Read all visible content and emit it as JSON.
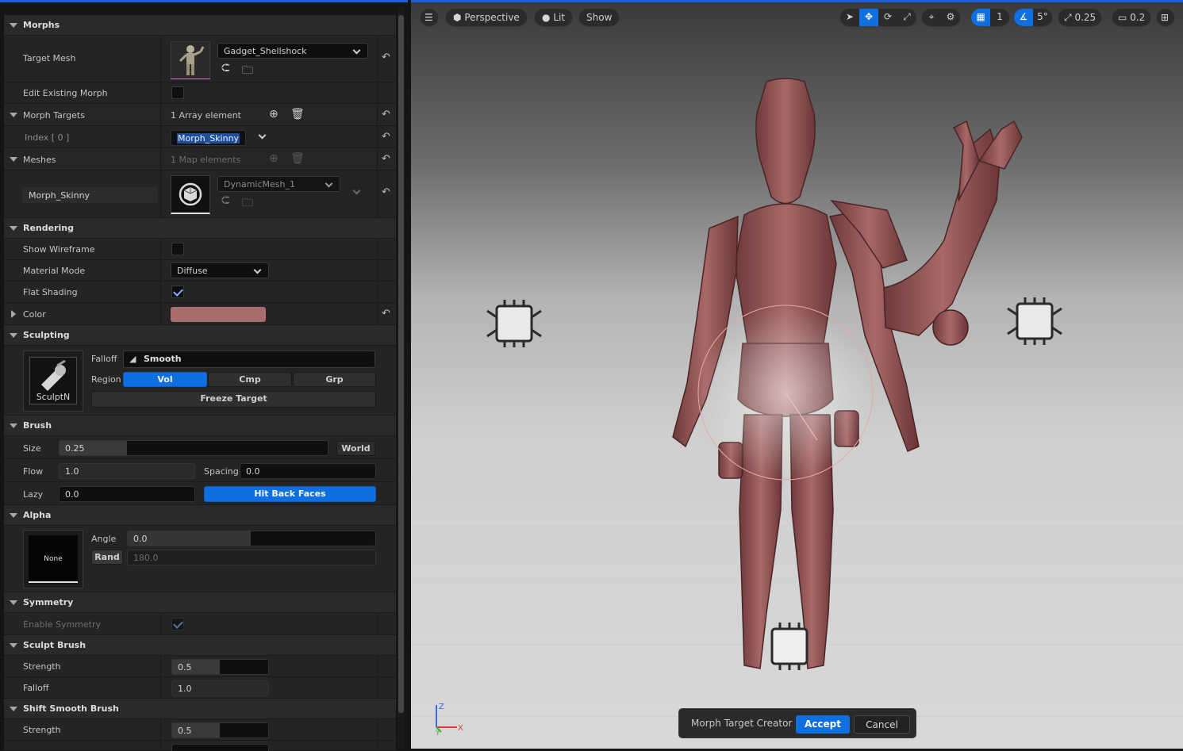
{
  "details": {
    "morphs": {
      "header": "Morphs",
      "target_mesh_label": "Target Mesh",
      "target_mesh_value": "Gadget_Shellshock",
      "edit_existing_label": "Edit Existing Morph",
      "morph_targets_label": "Morph Targets",
      "morph_targets_count": "1 Array element",
      "index_label": "Index [ 0 ]",
      "index_value": "Morph_Skinny",
      "meshes_label": "Meshes",
      "meshes_count": "1 Map elements",
      "mesh_key": "Morph_Skinny",
      "mesh_value": "DynamicMesh_1"
    },
    "rendering": {
      "header": "Rendering",
      "show_wireframe_label": "Show Wireframe",
      "material_mode_label": "Material Mode",
      "material_mode_value": "Diffuse",
      "flat_shading_label": "Flat Shading",
      "flat_shading_checked": true,
      "color_label": "Color",
      "color_value": "#a86e6e"
    },
    "sculpting": {
      "header": "Sculpting",
      "tool_name": "SculptN",
      "falloff_label": "Falloff",
      "falloff_value": "Smooth",
      "region_label": "Region",
      "region_options": [
        "Vol",
        "Cmp",
        "Grp"
      ],
      "region_selected": "Vol",
      "freeze_label": "Freeze Target"
    },
    "brush": {
      "header": "Brush",
      "size_label": "Size",
      "size_value": "0.25",
      "size_fraction": 0.25,
      "world_label": "World",
      "flow_label": "Flow",
      "flow_value": "1.0",
      "spacing_label": "Spacing",
      "spacing_value": "0.0",
      "lazy_label": "Lazy",
      "lazy_value": "0.0",
      "hit_back_faces_label": "Hit Back Faces"
    },
    "alpha": {
      "header": "Alpha",
      "alpha_name": "None",
      "angle_label": "Angle",
      "angle_value": "0.0",
      "rand_label": "Rand",
      "rand_value": "180.0"
    },
    "symmetry": {
      "header": "Symmetry",
      "enable_label": "Enable Symmetry"
    },
    "sculpt_brush": {
      "header": "Sculpt Brush",
      "strength_label": "Strength",
      "strength_value": "0.5",
      "falloff_label": "Falloff",
      "falloff_value": "1.0"
    },
    "shift_smooth": {
      "header": "Shift Smooth Brush",
      "strength_label": "Strength",
      "strength_value": "0.5"
    }
  },
  "viewport": {
    "perspective_label": "Perspective",
    "lit_label": "Lit",
    "show_label": "Show",
    "grid_snap_value": "1",
    "rotation_snap_value": "5°",
    "scale_snap_value": "0.25",
    "camera_speed_value": "0.2",
    "axis_x": "X",
    "axis_y": "Y",
    "axis_z": "Z",
    "mesh_color": "#9a5c5c"
  },
  "bottom_bar": {
    "title": "Morph Target Creator",
    "accept_label": "Accept",
    "cancel_label": "Cancel"
  },
  "accent_color": "#0f6fe0"
}
